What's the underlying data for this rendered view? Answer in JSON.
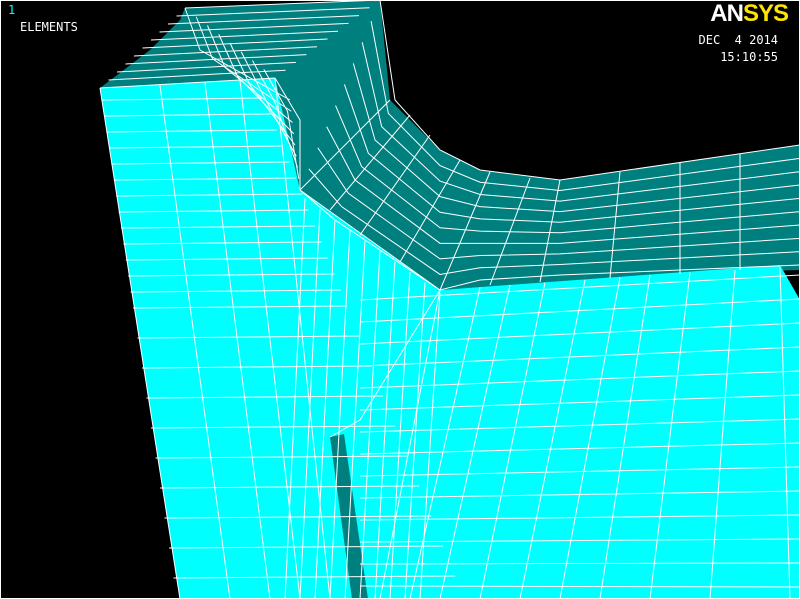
{
  "window_number": "1",
  "plot_label": "ELEMENTS",
  "logo": {
    "part1": "AN",
    "part2": "SYS"
  },
  "date": "DEC  4 2014",
  "time": "15:10:55",
  "colors": {
    "background": "#000000",
    "front_face": "#00FFFF",
    "side_face": "#007F7F",
    "mesh_lines": "#FFFFFF",
    "logo_yellow": "#FFE400"
  }
}
